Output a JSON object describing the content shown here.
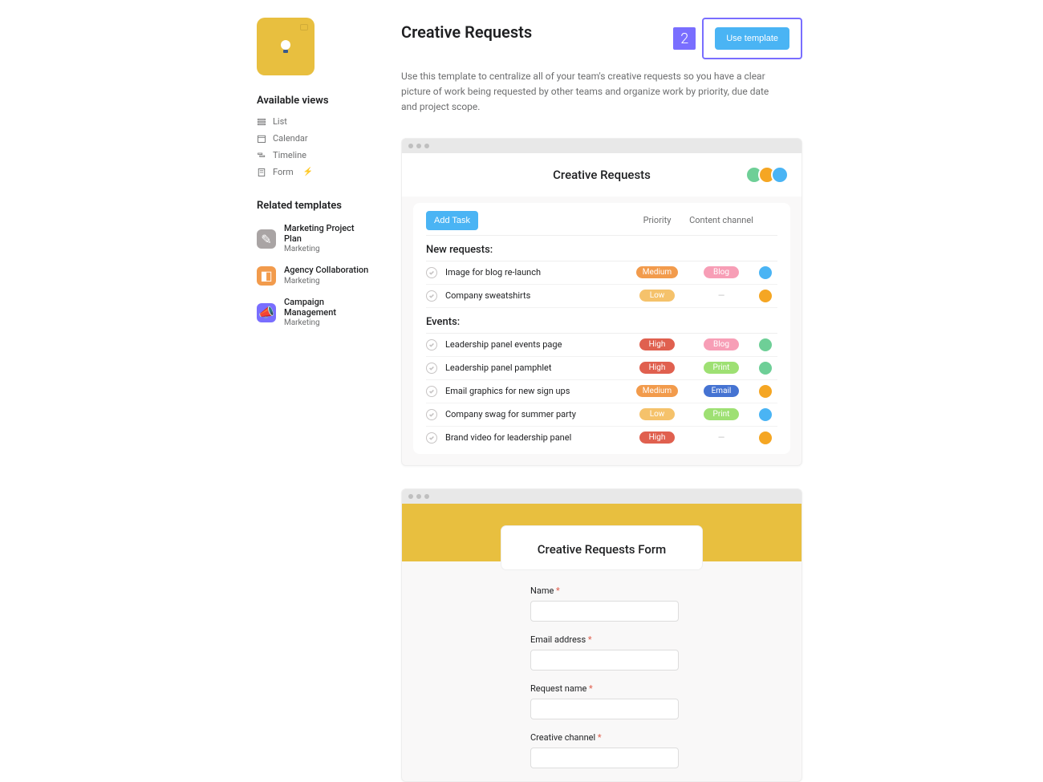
{
  "header": {
    "title": "Creative Requests",
    "description": "Use this template to centralize all of your team's creative requests so you have a clear picture of work being requested by other teams and organize work by priority, due date and project scope.",
    "callout_number": "2",
    "use_template_label": "Use template"
  },
  "sidebar": {
    "views_heading": "Available views",
    "views": [
      {
        "label": "List",
        "icon": "list-icon",
        "badge": false
      },
      {
        "label": "Calendar",
        "icon": "calendar-icon",
        "badge": false
      },
      {
        "label": "Timeline",
        "icon": "timeline-icon",
        "badge": false
      },
      {
        "label": "Form",
        "icon": "form-icon",
        "badge": true
      }
    ],
    "related_heading": "Related templates",
    "related": [
      {
        "name": "Marketing Project Plan",
        "category": "Marketing",
        "color": "#a9a4a4",
        "glyph": "✎"
      },
      {
        "name": "Agency Collaboration",
        "category": "Marketing",
        "color": "#f29b4c",
        "glyph": "◧"
      },
      {
        "name": "Campaign Management",
        "category": "Marketing",
        "color": "#796eff",
        "glyph": "📣"
      }
    ]
  },
  "preview_list": {
    "title": "Creative Requests",
    "add_task_label": "Add Task",
    "columns": {
      "priority": "Priority",
      "channel": "Content channel"
    },
    "avatar_colors": [
      "#6ecf97",
      "#f5a623",
      "#4ab4f4"
    ],
    "sections": [
      {
        "name": "New requests:",
        "tasks": [
          {
            "name": "Image for blog re-launch",
            "priority": "Medium",
            "priority_color": "#f29b4c",
            "channel": "Blog",
            "channel_color": "#f79eb6",
            "assignee": "#4ab4f4"
          },
          {
            "name": "Company sweatshirts",
            "priority": "Low",
            "priority_color": "#f5c26b",
            "channel": "",
            "channel_color": "",
            "assignee": "#f5a623"
          }
        ]
      },
      {
        "name": "Events:",
        "tasks": [
          {
            "name": "Leadership panel events page",
            "priority": "High",
            "priority_color": "#e0604f",
            "channel": "Blog",
            "channel_color": "#f79eb6",
            "assignee": "#6ecf97"
          },
          {
            "name": "Leadership panel pamphlet",
            "priority": "High",
            "priority_color": "#e0604f",
            "channel": "Print",
            "channel_color": "#9ee073",
            "assignee": "#6ecf97"
          },
          {
            "name": "Email graphics for new sign ups",
            "priority": "Medium",
            "priority_color": "#f29b4c",
            "channel": "Email",
            "channel_color": "#4573d2",
            "assignee": "#f5a623"
          },
          {
            "name": "Company swag for summer party",
            "priority": "Low",
            "priority_color": "#f5c26b",
            "channel": "Print",
            "channel_color": "#9ee073",
            "assignee": "#4ab4f4"
          },
          {
            "name": "Brand video for leadership panel",
            "priority": "High",
            "priority_color": "#e0604f",
            "channel": "",
            "channel_color": "",
            "assignee": "#f5a623"
          }
        ]
      }
    ]
  },
  "preview_form": {
    "title": "Creative Requests Form",
    "fields": [
      {
        "label": "Name",
        "required": true
      },
      {
        "label": "Email address",
        "required": true
      },
      {
        "label": "Request name",
        "required": true
      },
      {
        "label": "Creative channel",
        "required": true
      }
    ]
  }
}
